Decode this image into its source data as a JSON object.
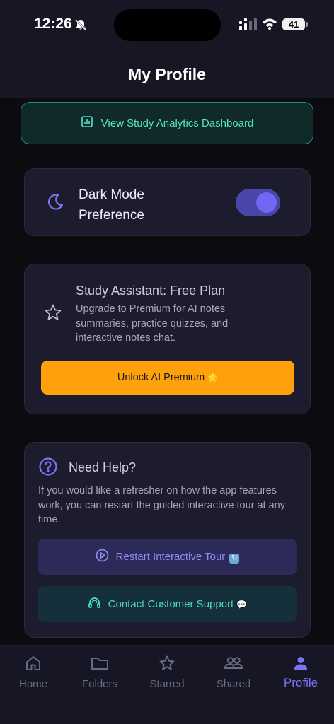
{
  "status_bar": {
    "time": "12:26",
    "battery": "41"
  },
  "header": {
    "title": "My Profile"
  },
  "analytics": {
    "label": "View Study Analytics Dashboard"
  },
  "dark_mode": {
    "label_line1": "Dark Mode",
    "label_line2": "Preference",
    "enabled": true
  },
  "premium": {
    "title": "Study Assistant: Free Plan",
    "description": "Upgrade to Premium for AI notes summaries, practice quizzes, and interactive notes chat.",
    "button_label": "Unlock AI Premium",
    "button_emoji": "🌟"
  },
  "help": {
    "title": "Need Help?",
    "description": "If you would like a refresher on how the app features work, you can restart the guided interactive tour at any time.",
    "tour_button": "Restart Interactive Tour",
    "support_button": "Contact Customer Support",
    "support_emoji": "💬"
  },
  "tabs": [
    {
      "label": "Home",
      "icon": "home-icon"
    },
    {
      "label": "Folders",
      "icon": "folder-icon"
    },
    {
      "label": "Starred",
      "icon": "star-icon"
    },
    {
      "label": "Shared",
      "icon": "users-icon"
    },
    {
      "label": "Profile",
      "icon": "person-icon",
      "active": true
    }
  ],
  "colors": {
    "accent": "#7b73f2",
    "teal": "#4fd8c3",
    "orange": "#ffa10a"
  }
}
